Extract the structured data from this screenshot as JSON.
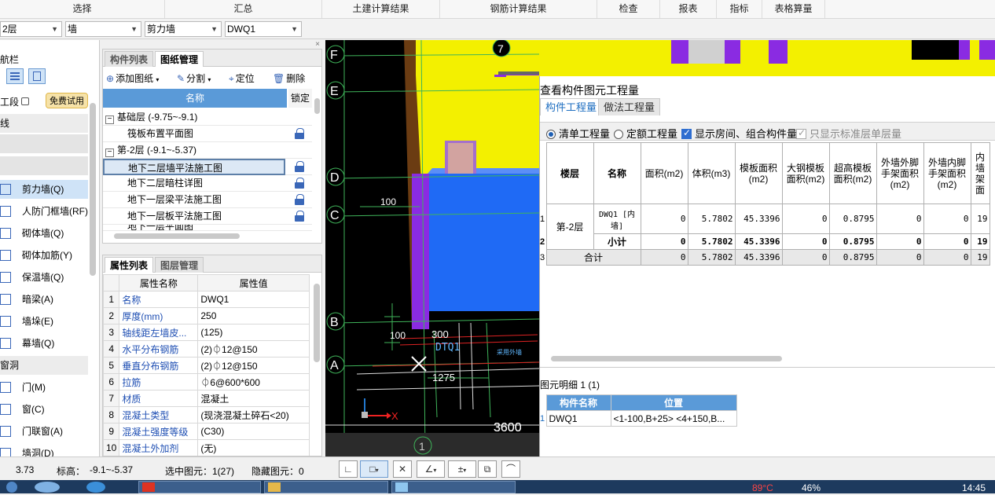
{
  "ribbon": [
    "选择",
    "汇总",
    "土建计算结果",
    "钢筋计算结果",
    "检查",
    "报表",
    "指标",
    "表格算量"
  ],
  "combos": {
    "floor": "2层",
    "category": "墙",
    "type": "剪力墙",
    "element": "DWQ1"
  },
  "nav": {
    "title": "航栏",
    "segment": "工段",
    "trial_badge": "免费试用",
    "cat_line": "线",
    "cat_hole": "窗洞",
    "items": [
      {
        "label": "剪力墙(Q)",
        "icon": "shear-wall-icon"
      },
      {
        "label": "人防门框墙(RF)",
        "icon": "civil-defense-door-frame-icon"
      },
      {
        "label": "砌体墙(Q)",
        "icon": "masonry-wall-icon"
      },
      {
        "label": "砌体加筋(Y)",
        "icon": "masonry-rebar-icon"
      },
      {
        "label": "保温墙(Q)",
        "icon": "insulation-wall-icon"
      },
      {
        "label": "暗梁(A)",
        "icon": "hidden-beam-icon"
      },
      {
        "label": "墙垛(E)",
        "icon": "wall-pier-icon"
      },
      {
        "label": "幕墙(Q)",
        "icon": "curtain-wall-icon"
      }
    ],
    "hole_items": [
      {
        "label": "门(M)",
        "icon": "door-icon"
      },
      {
        "label": "窗(C)",
        "icon": "window-icon"
      },
      {
        "label": "门联窗(A)",
        "icon": "door-window-icon"
      },
      {
        "label": "墙洞(D)",
        "icon": "wall-hole-icon"
      }
    ]
  },
  "drawing_panel": {
    "tabs": [
      "构件列表",
      "图纸管理"
    ],
    "toolbar": {
      "add": "添加图纸",
      "split": "分割",
      "locate": "定位",
      "delete": "删除"
    },
    "header": {
      "name": "名称",
      "lock": "锁定"
    },
    "tree": [
      {
        "label": "基础层 (-9.75~-9.1)",
        "group": true
      },
      {
        "label": "筏板布置平面图",
        "group": false
      },
      {
        "label": "第-2层 (-9.1~-5.37)",
        "group": true
      },
      {
        "label": "地下二层墙平法施工图",
        "group": false,
        "selected": true
      },
      {
        "label": "地下二层暗柱详图",
        "group": false
      },
      {
        "label": "地下一层梁平法施工图",
        "group": false
      },
      {
        "label": "地下一层板平法施工图",
        "group": false
      },
      {
        "label": "地下一层平面图",
        "group": false
      }
    ]
  },
  "property_panel": {
    "tabs": [
      "属性列表",
      "图层管理"
    ],
    "header": {
      "name": "属性名称",
      "value": "属性值"
    },
    "rows": [
      {
        "idx": "1",
        "name": "名称",
        "value": "DWQ1"
      },
      {
        "idx": "2",
        "name": "厚度(mm)",
        "value": "250"
      },
      {
        "idx": "3",
        "name": "轴线距左墙皮...",
        "value": "(125)"
      },
      {
        "idx": "4",
        "name": "水平分布钢筋",
        "value": "(2)⏀12@150"
      },
      {
        "idx": "5",
        "name": "垂直分布钢筋",
        "value": "(2)⏀12@150"
      },
      {
        "idx": "6",
        "name": "拉筋",
        "value": "⏀6@600*600"
      },
      {
        "idx": "7",
        "name": "材质",
        "value": "混凝土"
      },
      {
        "idx": "8",
        "name": "混凝土类型",
        "value": "(现浇混凝土碎石<20)"
      },
      {
        "idx": "9",
        "name": "混凝土强度等级",
        "value": "(C30)"
      },
      {
        "idx": "10",
        "name": "混凝土外加剂",
        "value": "(无)"
      }
    ]
  },
  "cad": {
    "axes_letters": [
      "F",
      "E",
      "D",
      "C",
      "B",
      "A"
    ],
    "axis_number": "1",
    "top_right_number": "7",
    "dims": {
      "d100a": "100",
      "d300": "300",
      "d100b": "100",
      "d1275": "1275",
      "d3600": "3600"
    },
    "wall_label": "DTQ1",
    "cn_label": "采用外墙",
    "x_axis": "X"
  },
  "dialog": {
    "title": "查看构件图元工程量",
    "tabs": [
      "构件工程量",
      "做法工程量"
    ],
    "options": {
      "list_qty": "清单工程量",
      "quota_qty": "定额工程量",
      "show_rooms": "显示房间、组合构件量",
      "std_floor": "只显示标准层单层量"
    },
    "columns": [
      "楼层",
      "名称",
      "面积(m2)",
      "体积(m3)",
      "模板面积(m2)",
      "大钢模板面积(m2)",
      "超高模板面积(m2)",
      "外墙外脚手架面积(m2)",
      "外墙内脚手架面积(m2)",
      "内墙架面"
    ],
    "rows": [
      {
        "rn": "1",
        "floor": "第-2层",
        "name": "DWQ1 [内墙]",
        "area": "0",
        "volume": "5.7802",
        "formwork": "45.3396",
        "steel": "0",
        "high": "0.8795",
        "out_out": "0",
        "out_in": "0",
        "inner": "19"
      },
      {
        "rn": "2",
        "floor": "",
        "name": "小计",
        "area": "0",
        "volume": "5.7802",
        "formwork": "45.3396",
        "steel": "0",
        "high": "0.8795",
        "out_out": "0",
        "out_in": "0",
        "inner": "19"
      },
      {
        "rn": "3",
        "floor": "合计",
        "name": "",
        "area": "0",
        "volume": "5.7802",
        "formwork": "45.3396",
        "steel": "0",
        "high": "0.8795",
        "out_out": "0",
        "out_in": "0",
        "inner": "19"
      }
    ],
    "detail_title": "图元明细  1 (1)",
    "detail_columns": [
      "构件名称",
      "位置"
    ],
    "detail_rows": [
      {
        "rn": "1",
        "name": "DWQ1",
        "pos": "<1-100,B+25> <4+150,B..."
      }
    ]
  },
  "status": {
    "coord": "3.73",
    "elev_label": "标高：",
    "elev": "-9.1~-5.37",
    "selected": "选中图元：1(27)",
    "hidden": "隐藏图元：0"
  },
  "taskbar": {
    "temp": "89°C",
    "pct": "46%",
    "time": "14:45"
  }
}
